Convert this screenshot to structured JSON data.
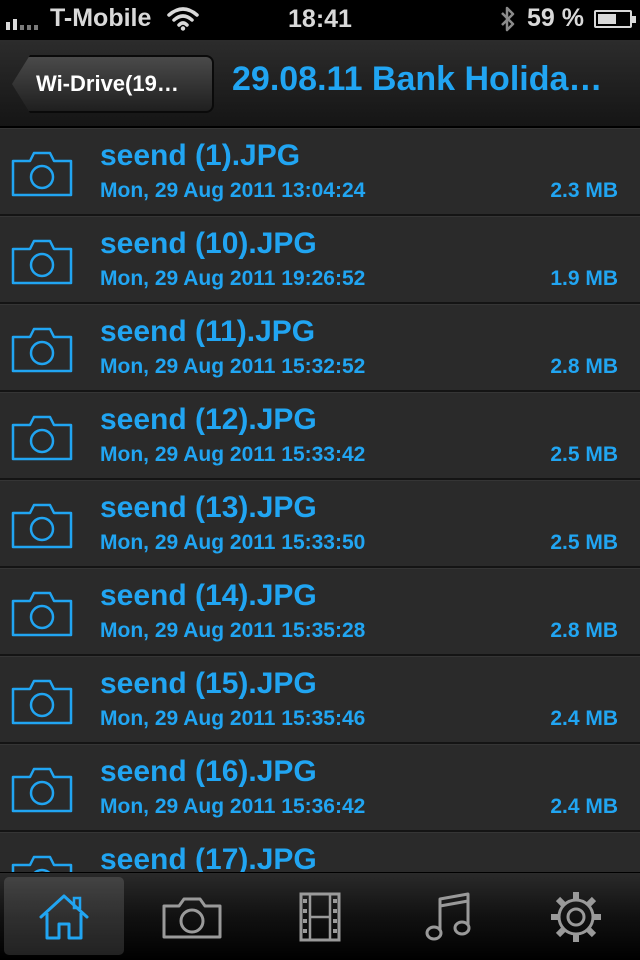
{
  "status_bar": {
    "carrier": "T-Mobile",
    "time": "18:41",
    "battery_percent": "59 %",
    "battery_level": 0.59
  },
  "nav": {
    "back_label": "Wi-Drive(19…",
    "title": "29.08.11 Bank Holida…"
  },
  "files": [
    {
      "name": "seend (1).JPG",
      "date": "Mon, 29 Aug 2011 13:04:24",
      "size": "2.3 MB"
    },
    {
      "name": "seend (10).JPG",
      "date": "Mon, 29 Aug 2011 19:26:52",
      "size": "1.9 MB"
    },
    {
      "name": "seend (11).JPG",
      "date": "Mon, 29 Aug 2011 15:32:52",
      "size": "2.8 MB"
    },
    {
      "name": "seend (12).JPG",
      "date": "Mon, 29 Aug 2011 15:33:42",
      "size": "2.5 MB"
    },
    {
      "name": "seend (13).JPG",
      "date": "Mon, 29 Aug 2011 15:33:50",
      "size": "2.5 MB"
    },
    {
      "name": "seend (14).JPG",
      "date": "Mon, 29 Aug 2011 15:35:28",
      "size": "2.8 MB"
    },
    {
      "name": "seend (15).JPG",
      "date": "Mon, 29 Aug 2011 15:35:46",
      "size": "2.4 MB"
    },
    {
      "name": "seend (16).JPG",
      "date": "Mon, 29 Aug 2011 15:36:42",
      "size": "2.4 MB"
    },
    {
      "name": "seend (17).JPG",
      "date": "",
      "size": ""
    }
  ],
  "tabs": [
    {
      "icon": "home-icon",
      "active": true
    },
    {
      "icon": "camera-icon",
      "active": false
    },
    {
      "icon": "film-icon",
      "active": false
    },
    {
      "icon": "music-icon",
      "active": false
    },
    {
      "icon": "gear-icon",
      "active": false
    }
  ],
  "colors": {
    "accent": "#21a5f2",
    "row_bg": "#2a2a2a",
    "status_bg": "#000000"
  }
}
